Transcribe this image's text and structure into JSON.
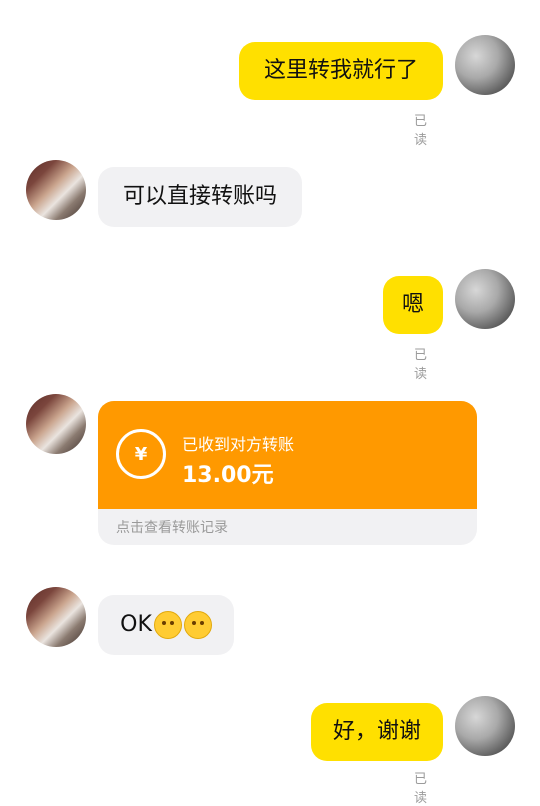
{
  "messages": [
    {
      "id": "m1",
      "side": "me",
      "text": "这里转我就行了",
      "read": "已读"
    },
    {
      "id": "m2",
      "side": "other",
      "text": "可以直接转账吗"
    },
    {
      "id": "m3",
      "side": "me",
      "text": "嗯",
      "read": "已读"
    },
    {
      "id": "m4",
      "side": "other",
      "type": "transfer",
      "title": "已收到对方转账",
      "amount": "13.00元",
      "link": "点击查看转账记录",
      "icon": "yen-refresh-icon"
    },
    {
      "id": "m5",
      "side": "other",
      "text": "OK",
      "emojis": [
        "sweat-smile-emoji",
        "sweat-smile-emoji"
      ]
    },
    {
      "id": "m6",
      "side": "me",
      "text": "好，谢谢",
      "read": "已读"
    }
  ],
  "colors": {
    "my_bubble": "#ffe000",
    "other_bubble": "#f1f1f3",
    "transfer": "#ff9900"
  }
}
